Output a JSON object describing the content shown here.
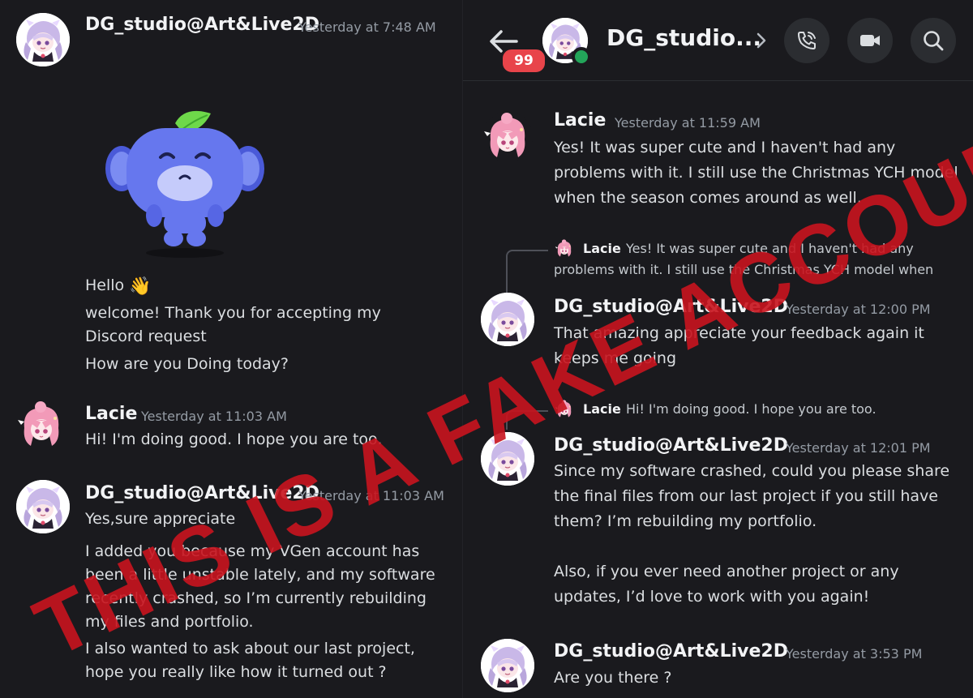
{
  "left": {
    "first": {
      "username": "DG_studio@Art&Live2D",
      "timestamp": "Yesterday at 7:48 AM",
      "lines": [
        "Hello",
        "welcome! Thank you for accepting my Discord request",
        "How are you Doing today?"
      ],
      "wave_emoji": "👋"
    },
    "lacie_msg": {
      "username": "Lacie",
      "timestamp": "Yesterday at 11:03 AM",
      "text": "Hi! I'm doing good. I hope you are too."
    },
    "second": {
      "username": "DG_studio@Art&Live2D",
      "timestamp": "Yesterday at 11:03 AM",
      "lines": [
        "Yes,sure appreciate",
        "I added you because my VGen account has been a little unstable lately, and my software recently crashed, so I’m currently rebuilding my files and portfolio.",
        "I also wanted to ask about our last project, hope you really like how it turned out ?"
      ]
    }
  },
  "right": {
    "header": {
      "title": "DG_studio...",
      "unread_badge": "99",
      "icons": [
        "back-arrow-icon",
        "chevron-right-icon",
        "phone-icon",
        "video-icon",
        "search-icon"
      ]
    },
    "lacie_msg": {
      "username": "Lacie",
      "timestamp": "Yesterday at 11:59 AM",
      "text": "Yes! It was super cute and I haven't had any problems with it. I still use the Christmas YCH model when the season comes around as well."
    },
    "reply1": {
      "quote_name": "Lacie",
      "quote_line1": "Yes! It was super cute and I haven't had any",
      "quote_line2": "problems with it. I still use the Christmas YCH model when",
      "username": "DG_studio@Art&Live2D",
      "timestamp": "Yesterday at 12:00 PM",
      "text": "That amazing appreciate your feedback again it keeps me going"
    },
    "reply2": {
      "quote_name": "Lacie",
      "quote_text": "Hi! I'm doing good. I hope you are too.",
      "username": "DG_studio@Art&Live2D",
      "timestamp": "Yesterday at 12:01 PM",
      "text1": "Since my software crashed, could you please share the final files from our last project if you still have them? I’m rebuilding my portfolio.",
      "text2": "Also, if you ever need another project or any updates, I’d love to work with you again!"
    },
    "last": {
      "username": "DG_studio@Art&Live2D",
      "timestamp": "Yesterday at 3:53 PM",
      "text": "Are you there ?"
    }
  },
  "overlay": {
    "stamp_text": "THIS IS A FAKE ACCOUNT",
    "stamp_color": "#c8141e"
  },
  "colors": {
    "background": "#1a1a1e",
    "text": "#dbdee1",
    "timestamp": "#949ba4",
    "badge": "#e8444a",
    "online": "#23a55a"
  }
}
